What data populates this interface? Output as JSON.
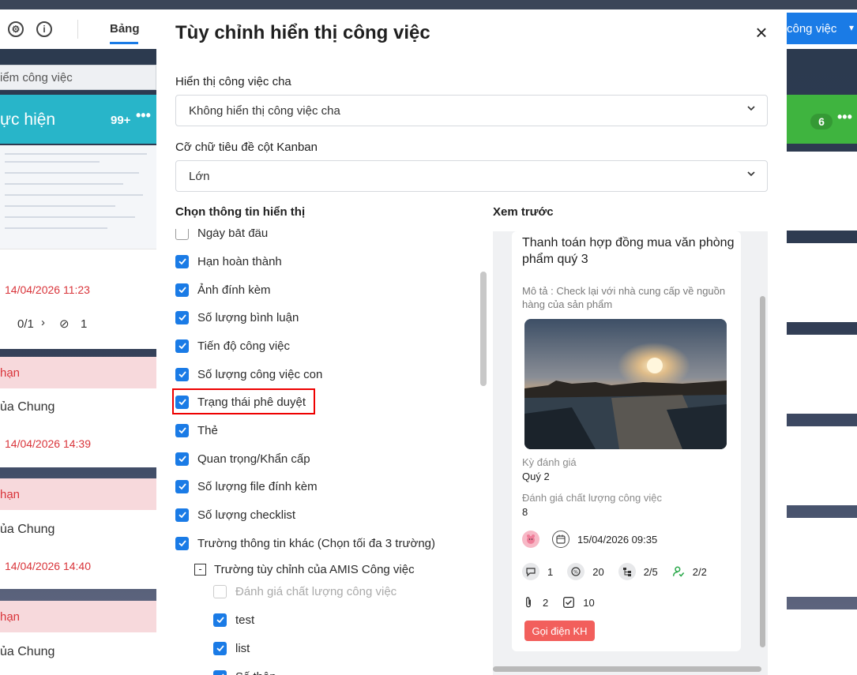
{
  "background": {
    "toolbar": {
      "tab_label": "Bảng",
      "right_button": "công việc"
    },
    "search_placeholder": "iểm công việc",
    "left_column": {
      "title": "ực hiện",
      "count": "99+",
      "dots": "•••"
    },
    "right_column": {
      "count": "6",
      "dots": "•••"
    },
    "cards": [
      {
        "date": "14/04/2026 11:23",
        "subtask": "0/1",
        "attach": "1"
      },
      {
        "badge": "hạn",
        "assignee": "ủa Chung",
        "date": "14/04/2026 14:39"
      },
      {
        "badge": "hạn",
        "assignee": "ủa Chung",
        "date": "14/04/2026 14:40"
      },
      {
        "badge": "hạn",
        "assignee": "ủa Chung"
      }
    ]
  },
  "modal": {
    "title": "Tùy chỉnh hiển thị công việc",
    "close": "×",
    "parent_task": {
      "label": "Hiển thị công việc cha",
      "value": "Không hiển thị công việc cha"
    },
    "font_size": {
      "label": "Cỡ chữ tiêu đề cột Kanban",
      "value": "Lớn"
    },
    "choose_label": "Chọn thông tin hiển thị",
    "preview_label": "Xem trước",
    "options": [
      {
        "label": "Ngày bắt đầu",
        "checked": false
      },
      {
        "label": "Hạn hoàn thành",
        "checked": true
      },
      {
        "label": "Ảnh đính kèm",
        "checked": true
      },
      {
        "label": "Số lượng bình luận",
        "checked": true
      },
      {
        "label": "Tiến độ công việc",
        "checked": true
      },
      {
        "label": "Số lượng công việc con",
        "checked": true
      },
      {
        "label": "Trạng thái phê duyệt",
        "checked": true
      },
      {
        "label": "Thẻ",
        "checked": true
      },
      {
        "label": "Quan trọng/Khẩn cấp",
        "checked": true
      },
      {
        "label": "Số lượng file đính kèm",
        "checked": true
      },
      {
        "label": "Số lượng checklist",
        "checked": true
      },
      {
        "label": "Trường thông tin khác (Chọn tối đa 3 trường)",
        "checked": true
      }
    ],
    "group": {
      "label": "Trường tùy chỉnh của AMIS Công việc",
      "items": [
        {
          "label": "Đánh giá chất lượng công việc",
          "checked": false,
          "disabled": true
        },
        {
          "label": "test",
          "checked": true
        },
        {
          "label": "list",
          "checked": true
        },
        {
          "label": "Số thập...",
          "checked": true
        }
      ]
    },
    "preview": {
      "title": "Thanh toán hợp đồng mua văn phòng phẩm quý 3",
      "description": "Mô tả : Check lại với nhà cung cấp về nguồn hàng của sản phẩm",
      "field1_label": "Kỳ đánh giá",
      "field1_value": "Quý 2",
      "field2_label": "Đánh giá chất lượng công việc",
      "field2_value": "8",
      "due": "15/04/2026 09:35",
      "comments": "1",
      "progress": "20",
      "subtasks": "2/5",
      "approvals": "2/2",
      "attachments": "2",
      "checklist": "10",
      "tag": "Gọi điện KH"
    }
  }
}
